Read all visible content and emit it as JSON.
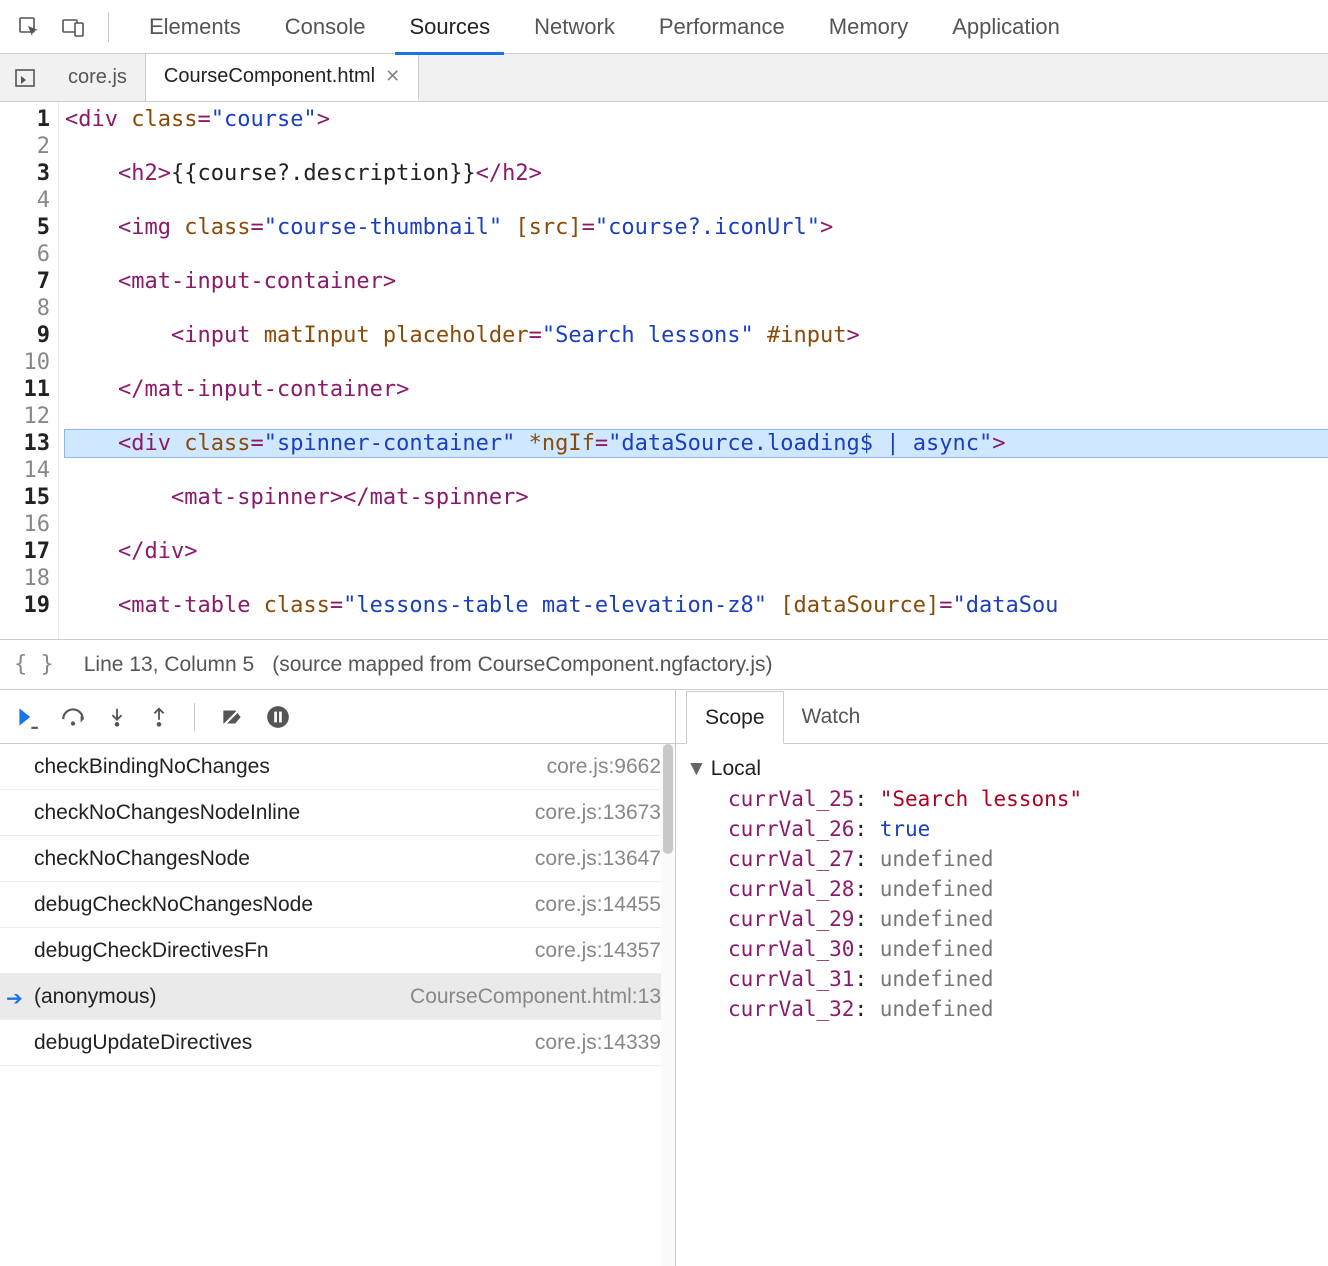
{
  "top_tabs": {
    "items": [
      "Elements",
      "Console",
      "Sources",
      "Network",
      "Performance",
      "Memory",
      "Application"
    ],
    "active_index": 2
  },
  "file_tabs": {
    "items": [
      {
        "label": "core.js",
        "closable": false
      },
      {
        "label": "CourseComponent.html",
        "closable": true
      }
    ],
    "active_index": 1
  },
  "editor": {
    "highlight_line": 13,
    "breakpoint_lines": [
      1,
      3,
      5,
      7,
      9,
      11,
      13,
      15,
      17,
      19
    ],
    "lines": [
      [
        [
          "tag",
          "<div"
        ],
        [
          "txt",
          " "
        ],
        [
          "attr",
          "class"
        ],
        [
          "tag",
          "="
        ],
        [
          "str",
          "\"course\""
        ],
        [
          "tag",
          ">"
        ]
      ],
      [],
      [
        [
          "txt",
          "    "
        ],
        [
          "tag",
          "<h2>"
        ],
        [
          "txt",
          "{{course?.description}}"
        ],
        [
          "tag",
          "</h2>"
        ]
      ],
      [],
      [
        [
          "txt",
          "    "
        ],
        [
          "tag",
          "<img"
        ],
        [
          "txt",
          " "
        ],
        [
          "attr",
          "class"
        ],
        [
          "tag",
          "="
        ],
        [
          "str",
          "\"course-thumbnail\""
        ],
        [
          "txt",
          " "
        ],
        [
          "attr",
          "[src]"
        ],
        [
          "tag",
          "="
        ],
        [
          "str",
          "\"course?.iconUrl\""
        ],
        [
          "tag",
          ">"
        ]
      ],
      [],
      [
        [
          "txt",
          "    "
        ],
        [
          "tag",
          "<mat-input-container>"
        ]
      ],
      [],
      [
        [
          "txt",
          "        "
        ],
        [
          "tag",
          "<input"
        ],
        [
          "txt",
          " "
        ],
        [
          "attr",
          "matInput"
        ],
        [
          "txt",
          " "
        ],
        [
          "attr",
          "placeholder"
        ],
        [
          "tag",
          "="
        ],
        [
          "str",
          "\"Search lessons\""
        ],
        [
          "txt",
          " "
        ],
        [
          "attr",
          "#input"
        ],
        [
          "tag",
          ">"
        ]
      ],
      [],
      [
        [
          "txt",
          "    "
        ],
        [
          "tag",
          "</mat-input-container>"
        ]
      ],
      [],
      [
        [
          "txt",
          "    "
        ],
        [
          "tag",
          "<div"
        ],
        [
          "txt",
          " "
        ],
        [
          "attr",
          "class"
        ],
        [
          "tag",
          "="
        ],
        [
          "str",
          "\"spinner-container\""
        ],
        [
          "txt",
          " "
        ],
        [
          "attr",
          "*ngIf"
        ],
        [
          "tag",
          "="
        ],
        [
          "str",
          "\"dataSource.loading$ | async\""
        ],
        [
          "tag",
          ">"
        ]
      ],
      [],
      [
        [
          "txt",
          "        "
        ],
        [
          "tag",
          "<mat-spinner>"
        ],
        [
          "tag",
          "</mat-spinner>"
        ]
      ],
      [],
      [
        [
          "txt",
          "    "
        ],
        [
          "tag",
          "</div>"
        ]
      ],
      [],
      [
        [
          "txt",
          "    "
        ],
        [
          "tag",
          "<mat-table"
        ],
        [
          "txt",
          " "
        ],
        [
          "attr",
          "class"
        ],
        [
          "tag",
          "="
        ],
        [
          "str",
          "\"lessons-table mat-elevation-z8\""
        ],
        [
          "txt",
          " "
        ],
        [
          "attr",
          "[dataSource]"
        ],
        [
          "tag",
          "="
        ],
        [
          "str",
          "\"dataSou"
        ]
      ]
    ]
  },
  "status": {
    "cursor": "Line 13, Column 5",
    "source_map": "(source mapped from CourseComponent.ngfactory.js)"
  },
  "callstack": {
    "selected_index": 5,
    "frames": [
      {
        "name": "checkBindingNoChanges",
        "loc": "core.js:9662"
      },
      {
        "name": "checkNoChangesNodeInline",
        "loc": "core.js:13673"
      },
      {
        "name": "checkNoChangesNode",
        "loc": "core.js:13647"
      },
      {
        "name": "debugCheckNoChangesNode",
        "loc": "core.js:14455"
      },
      {
        "name": "debugCheckDirectivesFn",
        "loc": "core.js:14357"
      },
      {
        "name": "(anonymous)",
        "loc": "CourseComponent.html:13"
      },
      {
        "name": "debugUpdateDirectives",
        "loc": "core.js:14339"
      }
    ]
  },
  "scope_tabs": {
    "items": [
      "Scope",
      "Watch"
    ],
    "active_index": 0
  },
  "scope": {
    "group": "Local",
    "vars": [
      {
        "name": "currVal_25",
        "value": "\"Search lessons\"",
        "kind": "str"
      },
      {
        "name": "currVal_26",
        "value": "true",
        "kind": "bool"
      },
      {
        "name": "currVal_27",
        "value": "undefined",
        "kind": "undef"
      },
      {
        "name": "currVal_28",
        "value": "undefined",
        "kind": "undef"
      },
      {
        "name": "currVal_29",
        "value": "undefined",
        "kind": "undef"
      },
      {
        "name": "currVal_30",
        "value": "undefined",
        "kind": "undef"
      },
      {
        "name": "currVal_31",
        "value": "undefined",
        "kind": "undef"
      },
      {
        "name": "currVal_32",
        "value": "undefined",
        "kind": "undef"
      }
    ]
  }
}
